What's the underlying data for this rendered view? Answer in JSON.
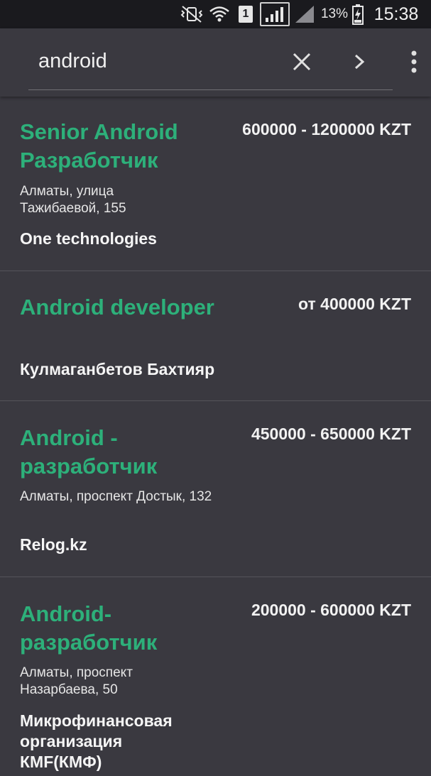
{
  "status_bar": {
    "sim_slot": "1",
    "battery_percent": "13%",
    "time": "15:38",
    "icons": [
      "mute-vibrate-icon",
      "wifi-icon",
      "sim-1-icon",
      "signal-icon",
      "signal-icon",
      "battery-charging-icon"
    ]
  },
  "search": {
    "query": "android",
    "clear_icon": "close-icon",
    "next_icon": "chevron-right-icon",
    "menu_icon": "more-vert-icon"
  },
  "colors": {
    "background": "#3a3940",
    "status_bar": "#1a1a1e",
    "title_accent": "#2db07a"
  },
  "vacancies": [
    {
      "title": "Senior Android Разработчик",
      "salary": "600000 - 1200000 KZT",
      "address": "Алматы, улица Тажибаевой, 155",
      "company": "One technologies"
    },
    {
      "title": "Android developer",
      "salary": "от 400000 KZT",
      "address": "",
      "company": "Кулмаганбетов Бахтияр"
    },
    {
      "title": "Android - разработчик",
      "salary": "450000 - 650000 KZT",
      "address": "Алматы, проспект Достык, 132",
      "company": "Relog.kz"
    },
    {
      "title": "Android-разработчик",
      "salary": "200000 - 600000 KZT",
      "address": "Алматы, проспект Назарбаева, 50",
      "company": "Микрофинансовая организация КМF(КМФ)"
    }
  ]
}
